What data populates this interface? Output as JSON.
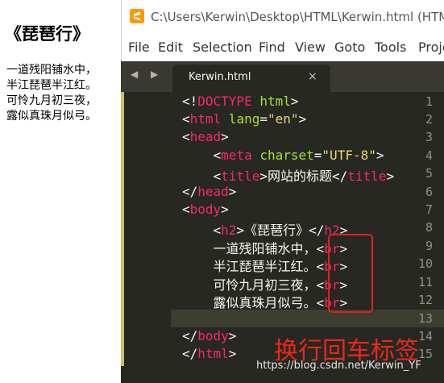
{
  "preview": {
    "heading": "《琵琶行》",
    "lines": [
      "一道残阳铺水中，",
      "半江琵琶半江红。",
      "可怜九月初三夜，",
      "露似真珠月似弓。"
    ]
  },
  "window": {
    "title": "C:\\Users\\Kerwin\\Desktop\\HTML\\Kerwin.html (HTM",
    "menu": [
      "File",
      "Edit",
      "Selection",
      "Find",
      "View",
      "Goto",
      "Tools",
      "Proje"
    ]
  },
  "tab": {
    "label": "Kerwin.html",
    "close": "×",
    "nav": "◀ ▶"
  },
  "line_numbers": [
    "1",
    "2",
    "3",
    "4",
    "5",
    "6",
    "7",
    "8",
    "9",
    "10",
    "11",
    "12",
    "13",
    "14",
    "15"
  ],
  "code": {
    "l1_open": "<!",
    "l1_doctype": "DOCTYPE",
    "l1_html": " html",
    "l1_close": ">",
    "l2_open": "<",
    "l2_tag": "html",
    "l2_attr": " lang",
    "l2_eq": "=",
    "l2_val": "\"en\"",
    "l2_close": ">",
    "l3": "head",
    "l4_attr": "charset",
    "l4_val": "\"UTF-8\"",
    "l4_tag": "meta",
    "l5_tag": "title",
    "l5_text": "网站的标题",
    "l6": "head",
    "l7": "body",
    "l8_tag": "h2",
    "l8_text": "《琵琶行》",
    "l9_text": "一道残阳铺水中，",
    "l10_text": "半江琵琶半江红。",
    "l11_text": "可怜九月初三夜，",
    "l12_text": "露似真珠月似弓。",
    "br": "br",
    "l14": "body",
    "l15": "html"
  },
  "annotation": "换行回车标签",
  "watermark": "https://blog.csdn.net/Kerwin_YF",
  "colors": {
    "editor_bg": "#272822",
    "tag": "#f92672",
    "attr": "#a6e22e",
    "string": "#e6db74",
    "annotation": "#e8281c"
  }
}
